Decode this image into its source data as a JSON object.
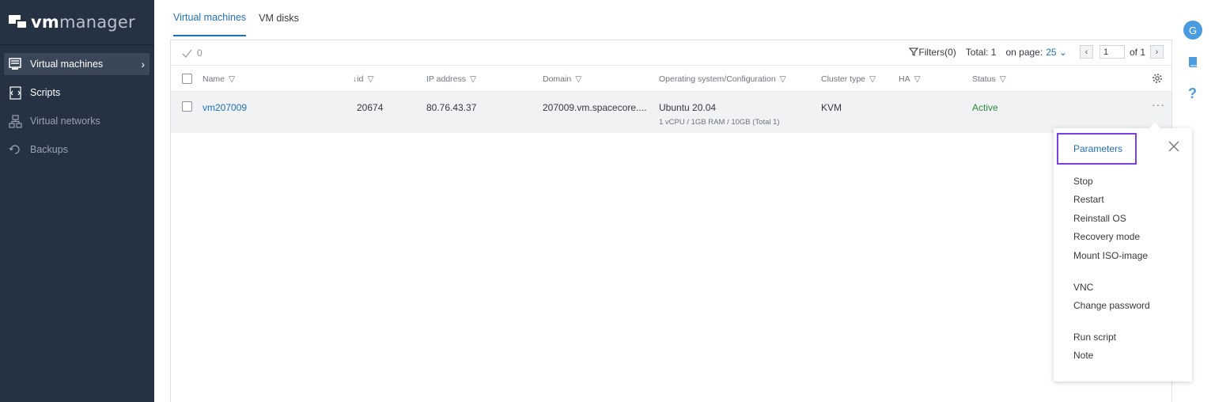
{
  "app": {
    "logo_bold": "vm",
    "logo_light": "manager"
  },
  "sidebar": {
    "items": [
      {
        "label": "Virtual machines",
        "icon": "vm-list-icon",
        "active": true
      },
      {
        "label": "Scripts",
        "icon": "script-icon"
      },
      {
        "label": "Virtual networks",
        "icon": "network-icon"
      },
      {
        "label": "Backups",
        "icon": "backup-icon"
      }
    ]
  },
  "tabs": [
    {
      "label": "Virtual machines",
      "active": true
    },
    {
      "label": "VM disks"
    }
  ],
  "toolbar": {
    "selected_count": "0",
    "filters_label": "Filters(0)",
    "total_label": "Total: 1",
    "on_page_label": "on page:",
    "on_page_value": "25",
    "page_value": "1",
    "of_label": "of",
    "page_total": "1"
  },
  "table": {
    "columns": [
      "Name",
      "id",
      "IP address",
      "Domain",
      "Operating system/Configuration",
      "Cluster type",
      "HA",
      "Status"
    ],
    "sort_indicator": "↓",
    "rows": [
      {
        "name": "vm207009",
        "id": "20674",
        "ip": "80.76.43.37",
        "domain": "207009.vm.spacecore....",
        "os": "Ubuntu 20.04",
        "config": "1 vCPU / 1GB RAM / 10GB (Total 1)",
        "cluster": "KVM",
        "ha": "",
        "status": "Active"
      }
    ]
  },
  "context_menu": {
    "items": [
      "Parameters",
      "Stop",
      "Restart",
      "Reinstall OS",
      "Recovery mode",
      "Mount ISO-image",
      "VNC",
      "Change password",
      "Run script",
      "Note"
    ]
  },
  "rail": {
    "avatar_letter": "G"
  },
  "colors": {
    "accent": "#1f6fb8",
    "sidebar": "#253243",
    "status_active": "#2e8b3e",
    "highlight": "#7b3fe4"
  }
}
